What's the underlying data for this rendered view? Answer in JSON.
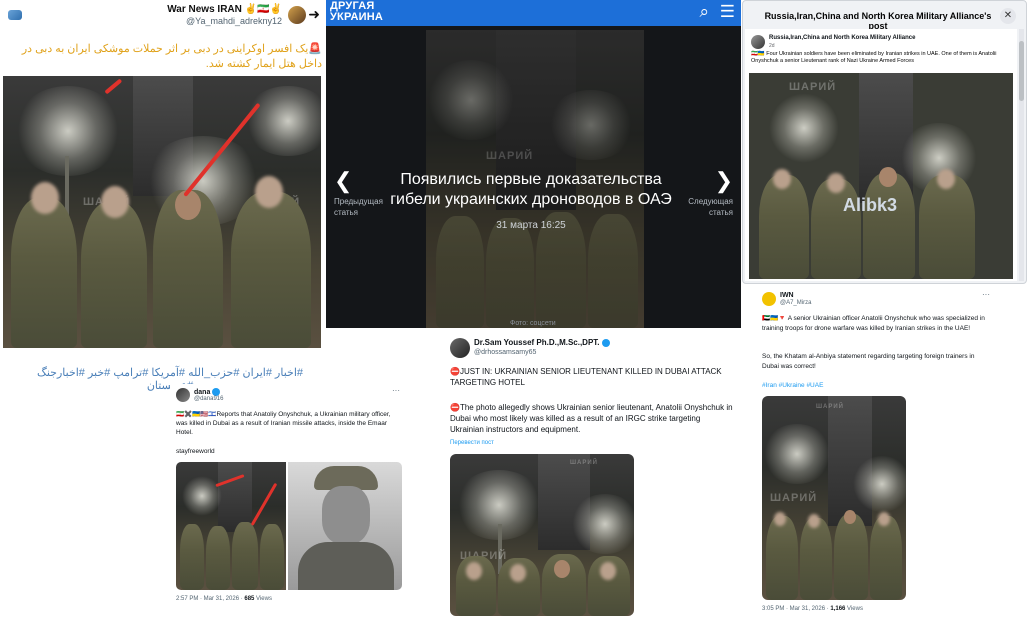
{
  "panel1": {
    "author_name": "War News IRAN ✌️🇮🇷✌️",
    "author_handle": "@Ya_mahdi_adrekny12",
    "text": "🚨یک افسر اوکراینی در دبی بر اثر حملات موشکی ایران به دبی در داخل هتل ایمار کشته شد.",
    "hashtags": "#اخبار #ایران #حزب_الله #آمریکا #ترامپ #خبر #اخبارجنگ #عربستان",
    "watermark": "ШАРИЙ"
  },
  "panel2": {
    "site_name_line1": "ДРУГАЯ",
    "site_name_line2": "УКРАИНА",
    "headline": "Появились первые доказательства гибели украинских дроноводов в ОАЭ",
    "date": "31 марта 16:25",
    "prev_label": "Предыдущая статья",
    "next_label": "Следующая статья",
    "photo_caption": "Фото: соцсети",
    "watermark": "ШАРИЙ"
  },
  "panel3": {
    "dialog_title": "Russia,Iran,China and North Korea Military Alliance's post",
    "page_name": "Russia,Iran,China and North Korea Military Alliance",
    "time": "2d",
    "text": "🇮🇷🇺🇦 Four Ukrainian soldiers have been eliminated by Iranian strikes in UAE. One of them is Anatolii Onyshchuk a senior Lieutenant rank of Nazi Ukraine Armed Forces",
    "photo_watermark": "Alibk3",
    "watermark": "ШАРИЙ"
  },
  "tweet_dana": {
    "name": "dana",
    "handle": "@dana916",
    "text": "🇮🇷✖️🇺🇦🇺🇸🇮🇱Reports that Anatoliy Onyshchuk, a Ukrainian military officer, was killed in Dubai as a result of Iranian missile attacks, inside the Emaar Hotel.",
    "signature": "stayfreeworld",
    "time": "2:57 PM · Mar 31, 2026 · ",
    "views_count": "685",
    "views_label": " Views"
  },
  "tweet_sam": {
    "name": "Dr.Sam Youssef Ph.D.,M.Sc.,DPT.",
    "handle": "@drhossamsamy65",
    "text1": "⛔JUST IN: UKRAINIAN SENIOR LIEUTENANT KILLED IN DUBAI ATTACK TARGETING HOTEL",
    "text2": "⛔The photo allegedly shows Ukrainian senior lieutenant, Anatolii Onyshchuk in Dubai who most likely was killed as a result of an IRGC strike targeting Ukrainian instructors and equipment.",
    "translate": "Перевести пост",
    "watermark": "ШАРИЙ"
  },
  "tweet_iwn": {
    "name": "IWN",
    "handle": "@A7_Mirza",
    "text1": "🇦🇪🇺🇦🔻 A senior Ukrainian officer Anatolii Onyshchuk who was specialized in training troops for drone warfare was killed by Iranian strikes in the UAE!",
    "text2": "So, the Khatam al-Anbiya statement regarding targeting foreign trainers in Dubai was correct!",
    "hashtags": "#Iran #Ukraine #UAE",
    "time": "3:05 PM · Mar 31, 2026 · ",
    "views_count": "1,166",
    "views_label": " Views",
    "watermark": "ШАРИЙ"
  },
  "colors": {
    "russian_site_bar": "#1d6fd8",
    "link_blue": "#1d9bf0",
    "farsi_text": "#e0a21b",
    "arrow_red": "#e0322b"
  },
  "icons": [
    "x-logo-icon",
    "arrow-right-icon",
    "search-icon",
    "menu-icon",
    "chevron-left-icon",
    "chevron-right-icon",
    "close-icon",
    "more-dots-icon",
    "verified-badge-icon"
  ]
}
